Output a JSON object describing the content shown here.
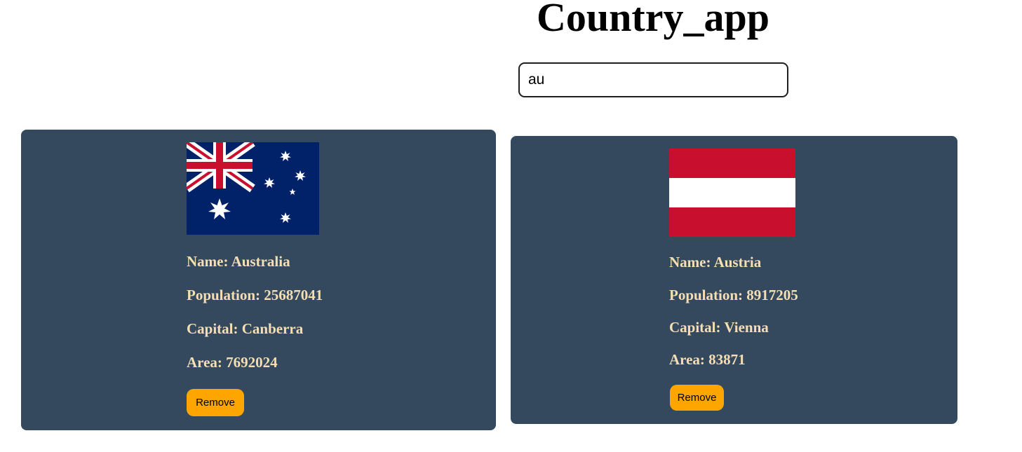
{
  "header": {
    "title": "Country_app"
  },
  "search": {
    "value": "au"
  },
  "countries": [
    {
      "flag": "australia-flag",
      "name_text": "Name: Australia",
      "population_text": "Population: 25687041",
      "capital_text": "Capital: Canberra",
      "area_text": "Area: 7692024",
      "remove_label": "Remove"
    },
    {
      "flag": "austria-flag",
      "name_text": "Name: Austria",
      "population_text": "Population: 8917205",
      "capital_text": "Capital: Vienna",
      "area_text": "Area: 83871",
      "remove_label": "Remove"
    }
  ],
  "colors": {
    "card_background": "#34495e",
    "info_text": "#f5deb3",
    "remove_button": "#ffa500"
  }
}
